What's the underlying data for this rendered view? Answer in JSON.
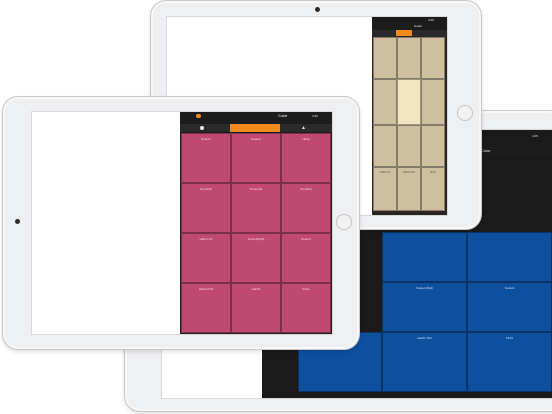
{
  "status": {
    "battery": "4:45"
  },
  "tabs": {
    "active_index": 1,
    "mode_label": "Guide",
    "color_label": "Color"
  },
  "themes": {
    "beige": "#cdbfa0",
    "beige_highlight": "#f1e5bf",
    "pink": "#bf4970",
    "blue": "#0e4f9e"
  },
  "pink_pads": [
    "Snare1",
    "Snare2",
    "Hihat",
    "Tom1(Hi)",
    "Tom(mid)",
    "Tom2(lo)",
    "HatOn.hh",
    "Snare1(Roll)",
    "Snare3",
    "HatOn.hh2",
    "HatO2",
    "Kick1"
  ],
  "blue_pads": [
    "Snare1(Roll)",
    "Snare3",
    "HatOn.hh2",
    "Kick1"
  ],
  "beige_pads": [
    "HatOn.hh",
    "HatOn.hh2",
    "Kick1"
  ]
}
